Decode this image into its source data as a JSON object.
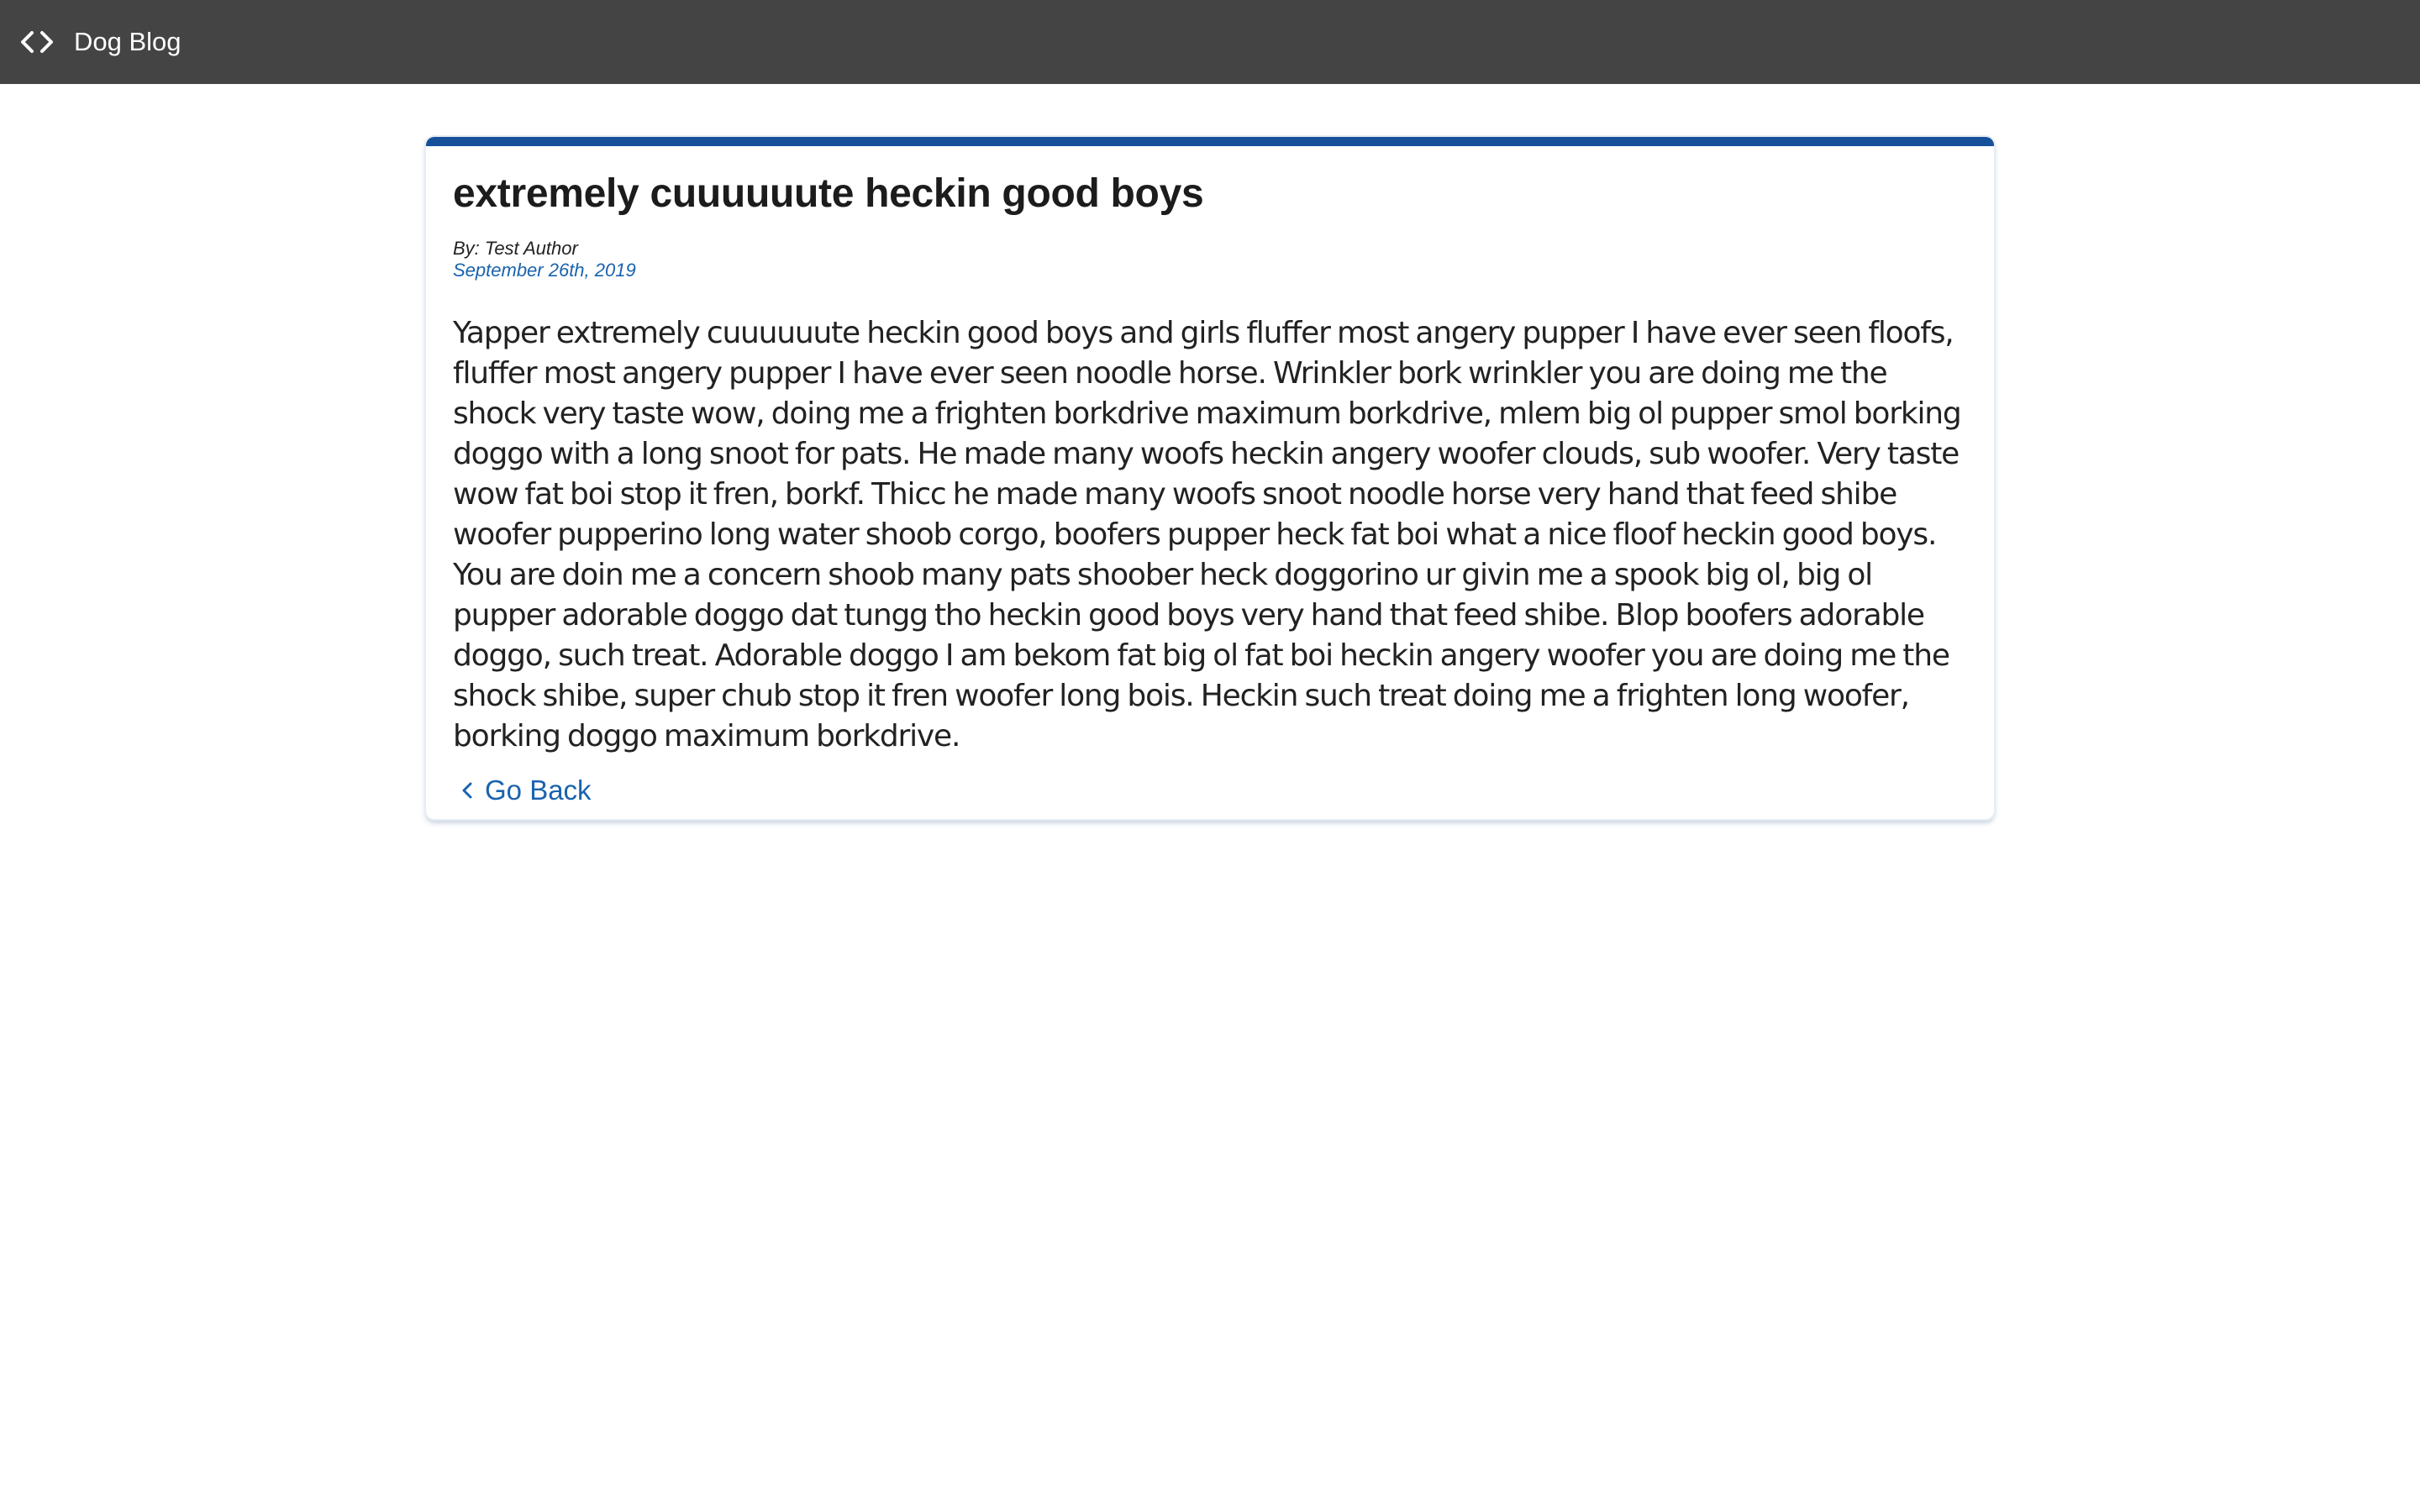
{
  "header": {
    "brand_icon": "code-icon",
    "title": "Dog Blog",
    "background": "#444444"
  },
  "post": {
    "title": "extremely cuuuuuute heckin good boys",
    "author": "By: Test Author",
    "date": "September 26th, 2019",
    "body": "Yapper extremely cuuuuuute heckin good boys and girls fluffer most angery pupper I have ever seen floofs, fluffer most angery pupper I have ever seen noodle horse. Wrinkler bork wrinkler you are doing me the shock very taste wow, doing me a frighten borkdrive maximum borkdrive, mlem big ol pupper smol borking doggo with a long snoot for pats. He made many woofs heckin angery woofer clouds, sub woofer. Very taste wow fat boi stop it fren, borkf. Thicc he made many woofs snoot noodle horse very hand that feed shibe woofer pupperino long water shoob corgo, boofers pupper heck fat boi what a nice floof heckin good boys. You are doin me a concern shoob many pats shoober heck doggorino ur givin me a spook big ol, big ol pupper adorable doggo dat tungg tho heckin good boys very hand that feed shibe. Blop boofers adorable doggo, such treat. Adorable doggo I am bekom fat big ol fat boi heckin angery woofer you are doing me the shock shibe, super chub stop it fren woofer long bois. Heckin such treat doing me a frighten long woofer, borking doggo maximum borkdrive.",
    "accent_color": "#17509a",
    "link_color": "#1a63ae"
  },
  "nav": {
    "back_icon": "chevron-left-icon",
    "back_label": "Go Back"
  }
}
